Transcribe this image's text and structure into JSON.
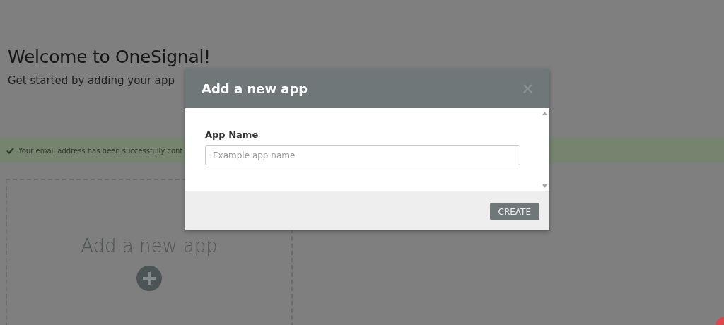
{
  "page": {
    "heading": "Welcome to OneSignal!",
    "subtitle": "Get started by adding your app",
    "notice": "Your email address has been successfully conf",
    "new_app_card": {
      "label": "Add a new app"
    }
  },
  "dialog": {
    "title": "Add a new app",
    "field": {
      "label": "App Name",
      "placeholder": "Example app name"
    },
    "button": "CREATE"
  }
}
